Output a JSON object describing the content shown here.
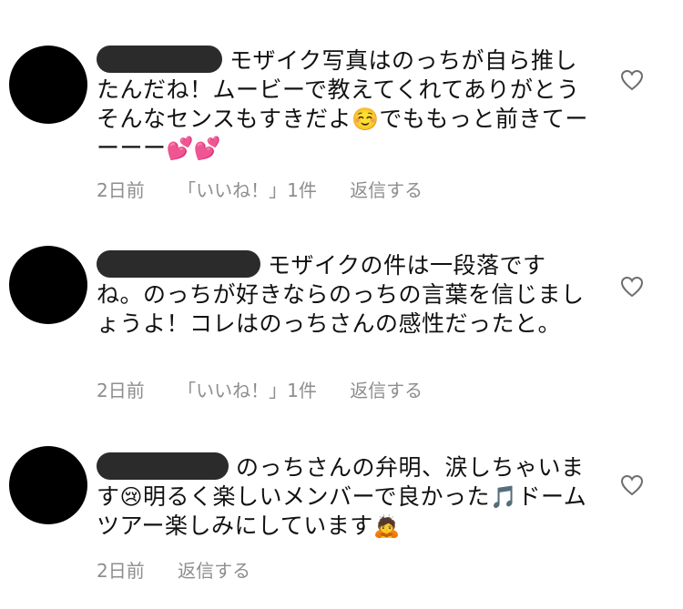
{
  "comments": [
    {
      "text": "モザイク写真はのっちが自ら推したんだね！ムービーで教えてくれてありがとう そんなセンスもすきだよ",
      "emoji1": "☺️",
      "text2": "でももっと前きてーーーー",
      "emoji2": "💕💕",
      "time": "2日前",
      "likes": "「いいね！」1件",
      "reply": "返信する",
      "heart_icon": "heart-outline-icon"
    },
    {
      "text": "モザイクの件は一段落ですね。のっちが好きならのっちの言葉を信じましょうよ！コレはのっちさんの感性だったと。",
      "time": "2日前",
      "likes": "「いいね！」1件",
      "reply": "返信する",
      "heart_icon": "heart-outline-icon"
    },
    {
      "text": "のっちさんの弁明、涙しちゃいます",
      "emoji1": "😢",
      "text2": "明るく楽しいメンバーで良かった",
      "emoji2": "🎵",
      "text3": "ドームツアー楽しみにしています",
      "emoji3": "🙇",
      "time": "2日前",
      "reply": "返信する",
      "heart_icon": "heart-outline-icon"
    }
  ]
}
